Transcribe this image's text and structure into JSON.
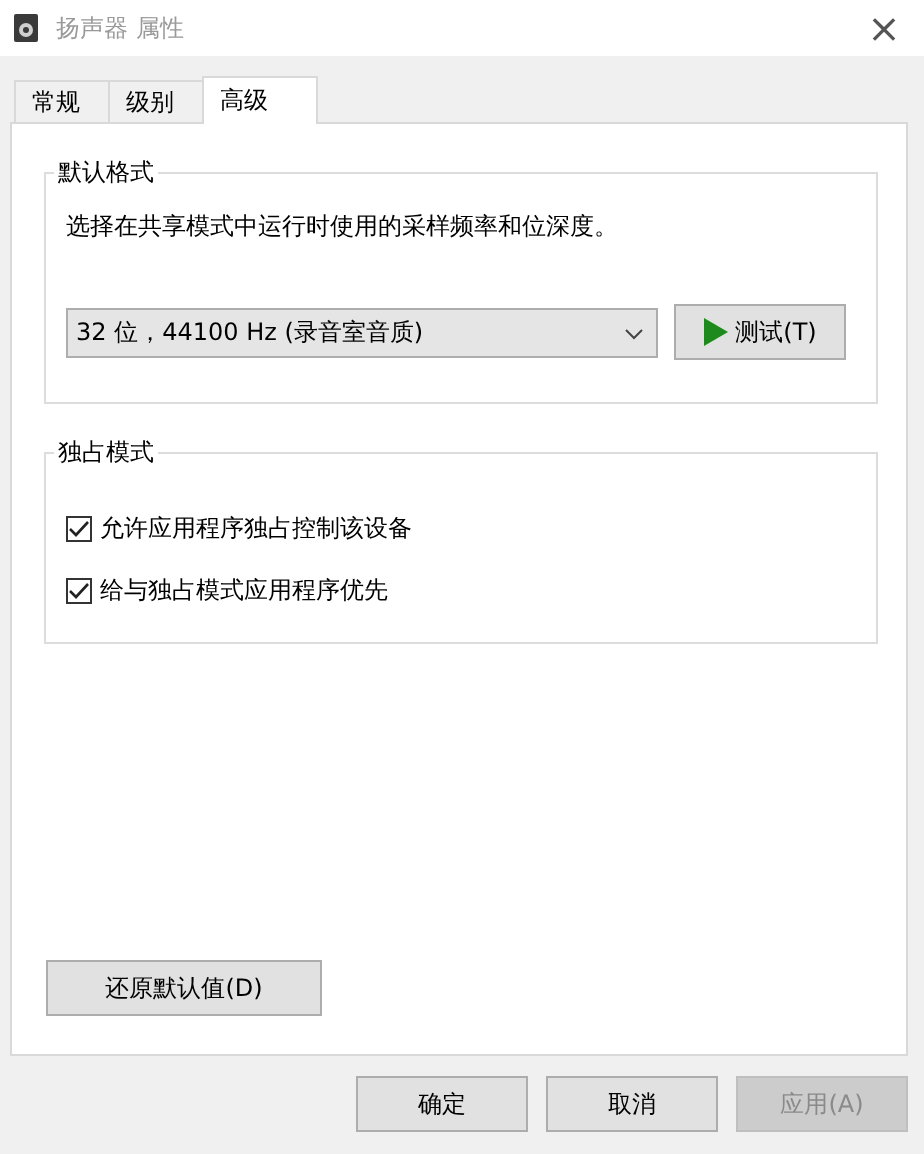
{
  "window": {
    "title": "扬声器 属性",
    "close": "×"
  },
  "tabs": [
    {
      "label": "常规",
      "selected": false
    },
    {
      "label": "级别",
      "selected": false
    },
    {
      "label": "高级",
      "selected": true
    }
  ],
  "default_format": {
    "title": "默认格式",
    "description": "选择在共享模式中运行时使用的采样频率和位深度。",
    "format_value": "32 位，44100 Hz (录音室音质)",
    "test_button": "测试(T)"
  },
  "exclusive_mode": {
    "title": "独占模式",
    "options": [
      {
        "label": "允许应用程序独占控制该设备",
        "checked": true
      },
      {
        "label": "给与独占模式应用程序优先",
        "checked": true
      }
    ]
  },
  "restore_button": "还原默认值(D)",
  "buttons": [
    {
      "label": "确定",
      "disabled": false
    },
    {
      "label": "取消",
      "disabled": false
    },
    {
      "label": "应用(A)",
      "disabled": true
    }
  ]
}
